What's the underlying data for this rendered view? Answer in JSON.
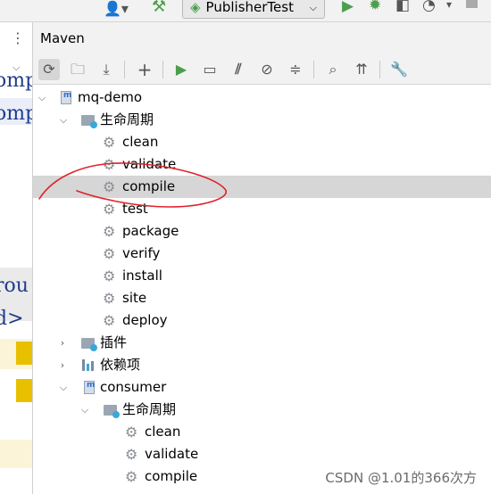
{
  "topbar": {
    "run_config": "PublisherTest",
    "icons": [
      "user-icon",
      "hammer-icon",
      "run-icon",
      "debug-icon",
      "coverage-icon",
      "profile-icon",
      "more-icon"
    ]
  },
  "editor": {
    "code_lines": [
      "omp",
      "omp",
      "rou",
      "d>"
    ]
  },
  "maven": {
    "title": "Maven",
    "toolbar_icons": [
      "reload-icon",
      "add-folder-icon",
      "download-icon",
      "plus-icon",
      "run-icon",
      "toggle-offline-icon",
      "skip-tests-icon",
      "stop-icon",
      "collapse-icon",
      "analyze-icon",
      "show-dependencies-icon",
      "settings-icon"
    ],
    "tree": [
      {
        "label": "mq-demo",
        "kind": "project",
        "level": 0,
        "expanded": true
      },
      {
        "label": "生命周期",
        "kind": "folder",
        "level": 1,
        "expanded": true
      },
      {
        "label": "clean",
        "kind": "goal",
        "level": 2
      },
      {
        "label": "validate",
        "kind": "goal",
        "level": 2
      },
      {
        "label": "compile",
        "kind": "goal",
        "level": 2,
        "selected": true
      },
      {
        "label": "test",
        "kind": "goal",
        "level": 2
      },
      {
        "label": "package",
        "kind": "goal",
        "level": 2
      },
      {
        "label": "verify",
        "kind": "goal",
        "level": 2
      },
      {
        "label": "install",
        "kind": "goal",
        "level": 2
      },
      {
        "label": "site",
        "kind": "goal",
        "level": 2
      },
      {
        "label": "deploy",
        "kind": "goal",
        "level": 2
      },
      {
        "label": "插件",
        "kind": "folder",
        "level": 1,
        "expanded": false
      },
      {
        "label": "依赖项",
        "kind": "deps",
        "level": 1,
        "expanded": false
      },
      {
        "label": "consumer",
        "kind": "project",
        "level": 1,
        "expanded": true
      },
      {
        "label": "生命周期",
        "kind": "folder",
        "level": 2,
        "expanded": true
      },
      {
        "label": "clean",
        "kind": "goal",
        "level": 3
      },
      {
        "label": "validate",
        "kind": "goal",
        "level": 3
      },
      {
        "label": "compile",
        "kind": "goal",
        "level": 3
      }
    ]
  },
  "watermark": "CSDN @1.01的366次方",
  "colors": {
    "selection": "#d6d6d6",
    "annotation": "#e0202a",
    "run": "#4c9e4c"
  }
}
